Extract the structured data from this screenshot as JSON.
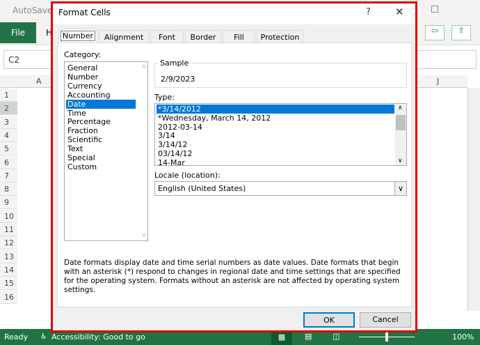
{
  "excel": {
    "autosave": "AutoSave",
    "file_tab": "File",
    "home_tab_initial": "H",
    "name_box": "C2",
    "col_a": "A",
    "col_j": "J",
    "rows": [
      "1",
      "2",
      "3",
      "4",
      "5",
      "6",
      "7",
      "8",
      "9",
      "10",
      "11",
      "12",
      "13",
      "14",
      "15",
      "16"
    ],
    "status": {
      "ready": "Ready",
      "accessibility": "Accessibility: Good to go",
      "zoom": "100%"
    }
  },
  "dialog": {
    "title": "Format Cells",
    "help": "?",
    "close": "✕",
    "tabs": [
      "Number",
      "Alignment",
      "Font",
      "Border",
      "Fill",
      "Protection"
    ],
    "category_label": "Category:",
    "categories": [
      "General",
      "Number",
      "Currency",
      "Accounting",
      "Date",
      "Time",
      "Percentage",
      "Fraction",
      "Scientific",
      "Text",
      "Special",
      "Custom"
    ],
    "selected_category": "Date",
    "sample_label": "Sample",
    "sample_value": "2/9/2023",
    "type_label": "Type:",
    "types": [
      "*3/14/2012",
      "*Wednesday, March 14, 2012",
      "2012-03-14",
      "3/14",
      "3/14/12",
      "03/14/12",
      "14-Mar"
    ],
    "locale_label": "Locale (location):",
    "locale_value": "English (United States)",
    "description": "Date formats display date and time serial numbers as date values.  Date formats that begin with an asterisk (*) respond to changes in regional date and time settings that are specified for the operating system. Formats without an asterisk are not affected by operating system settings.",
    "ok": "OK",
    "cancel": "Cancel"
  },
  "colors": {
    "excel_green": "#217346",
    "highlight": "#e00000",
    "selection": "#0078d7"
  }
}
